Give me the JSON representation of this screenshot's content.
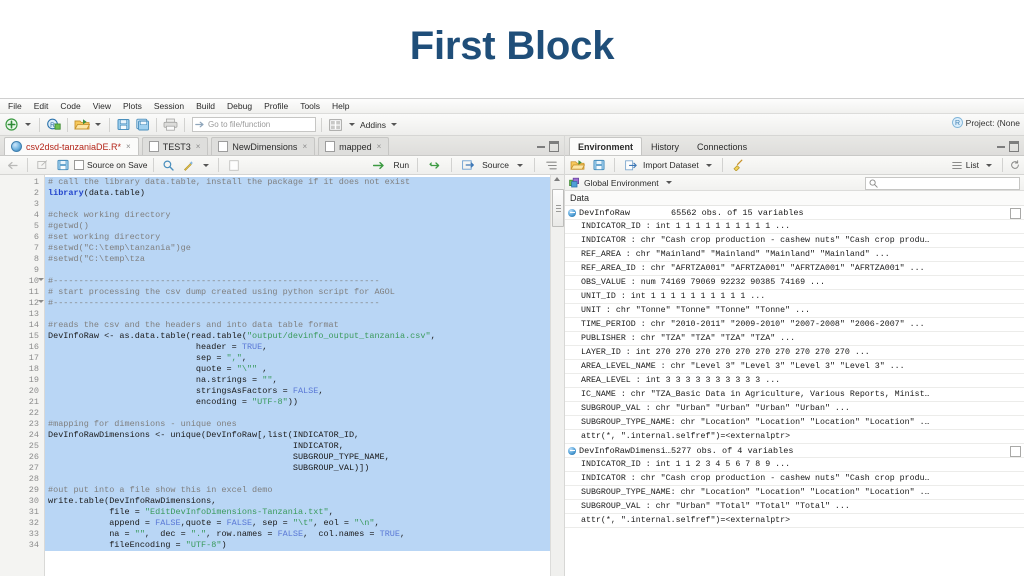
{
  "slide": {
    "title": "First Block"
  },
  "menubar": {
    "items": [
      "File",
      "Edit",
      "Code",
      "View",
      "Plots",
      "Session",
      "Build",
      "Debug",
      "Profile",
      "Tools",
      "Help"
    ]
  },
  "toolbar": {
    "goto_placeholder": "Go to file/function",
    "addins_label": "Addins",
    "project_label": "Project: (None"
  },
  "source_pane": {
    "tabs": [
      {
        "label": "csv2dsd-tanzaniaDE.R*",
        "icon": "r-script-icon",
        "active": true,
        "close": "×"
      },
      {
        "label": "TEST3",
        "icon": "file-icon",
        "active": false,
        "close": "×"
      },
      {
        "label": "NewDimensions",
        "icon": "file-icon",
        "active": false,
        "close": "×"
      },
      {
        "label": "mapped",
        "icon": "file-icon",
        "active": false,
        "close": "×"
      }
    ],
    "editor_toolbar": {
      "source_on_save": "Source on Save",
      "run_label": "Run",
      "source_label": "Source"
    },
    "gutter": [
      {
        "n": "1"
      },
      {
        "n": "2"
      },
      {
        "n": "3"
      },
      {
        "n": "4"
      },
      {
        "n": "5"
      },
      {
        "n": "6"
      },
      {
        "n": "7"
      },
      {
        "n": "8"
      },
      {
        "n": "9"
      },
      {
        "n": "10",
        "fold": true
      },
      {
        "n": "11"
      },
      {
        "n": "12",
        "fold": true
      },
      {
        "n": "13"
      },
      {
        "n": "14"
      },
      {
        "n": "15"
      },
      {
        "n": "16"
      },
      {
        "n": "17"
      },
      {
        "n": "18"
      },
      {
        "n": "19"
      },
      {
        "n": "20"
      },
      {
        "n": "21"
      },
      {
        "n": "22"
      },
      {
        "n": "23"
      },
      {
        "n": "24"
      },
      {
        "n": "25"
      },
      {
        "n": "26"
      },
      {
        "n": "27"
      },
      {
        "n": "28"
      },
      {
        "n": "29"
      },
      {
        "n": "30"
      },
      {
        "n": "31"
      },
      {
        "n": "32"
      },
      {
        "n": "33"
      },
      {
        "n": "34"
      }
    ],
    "code_lines": [
      [
        {
          "t": "# call the library data.table, install the package if it does not exist",
          "c": "cm"
        }
      ],
      [
        {
          "t": "library",
          "c": "kw"
        },
        {
          "t": "(data.table)",
          "c": "id"
        }
      ],
      [
        {
          "t": "",
          "c": "id"
        }
      ],
      [
        {
          "t": "#check working directory",
          "c": "cm"
        }
      ],
      [
        {
          "t": "#getwd()",
          "c": "cm"
        }
      ],
      [
        {
          "t": "#set working directory",
          "c": "cm"
        }
      ],
      [
        {
          "t": "#setwd(\"C:\\temp\\tanzania\")ge",
          "c": "cm"
        }
      ],
      [
        {
          "t": "#setwd(\"C:\\temp\\tza",
          "c": "cm"
        }
      ],
      [
        {
          "t": "",
          "c": "id"
        }
      ],
      [
        {
          "t": "#----------------------------------------------------------------",
          "c": "cm"
        }
      ],
      [
        {
          "t": "# start processing the csv dump created using python script for AGOL",
          "c": "cm"
        }
      ],
      [
        {
          "t": "#----------------------------------------------------------------",
          "c": "cm"
        }
      ],
      [
        {
          "t": "",
          "c": "id"
        }
      ],
      [
        {
          "t": "#reads the csv and the headers and into data table format",
          "c": "cm"
        }
      ],
      [
        {
          "t": "DevInfoRaw <- as.data.table(read.table(",
          "c": "id"
        },
        {
          "t": "\"output/devinfo_output_tanzania.csv\"",
          "c": "st"
        },
        {
          "t": ",",
          "c": "id"
        }
      ],
      [
        {
          "t": "                             header = ",
          "c": "id"
        },
        {
          "t": "TRUE",
          "c": "cn"
        },
        {
          "t": ",",
          "c": "id"
        }
      ],
      [
        {
          "t": "                             sep = ",
          "c": "id"
        },
        {
          "t": "\",\"",
          "c": "st"
        },
        {
          "t": ",",
          "c": "id"
        }
      ],
      [
        {
          "t": "                             quote = ",
          "c": "id"
        },
        {
          "t": "\"\\\"\"",
          "c": "st"
        },
        {
          "t": " ,",
          "c": "id"
        }
      ],
      [
        {
          "t": "                             na.strings = ",
          "c": "id"
        },
        {
          "t": "\"\"",
          "c": "st"
        },
        {
          "t": ",",
          "c": "id"
        }
      ],
      [
        {
          "t": "                             stringsAsFactors = ",
          "c": "id"
        },
        {
          "t": "FALSE",
          "c": "cn"
        },
        {
          "t": ",",
          "c": "id"
        }
      ],
      [
        {
          "t": "                             encoding = ",
          "c": "id"
        },
        {
          "t": "\"UTF-8\"",
          "c": "st"
        },
        {
          "t": "))",
          "c": "id"
        }
      ],
      [
        {
          "t": "",
          "c": "id"
        }
      ],
      [
        {
          "t": "#mapping for dimensions - unique ones",
          "c": "cm"
        }
      ],
      [
        {
          "t": "DevInfoRawDimensions <- unique(DevInfoRaw[,list(INDICATOR_ID,",
          "c": "id"
        }
      ],
      [
        {
          "t": "                                                INDICATOR,",
          "c": "id"
        }
      ],
      [
        {
          "t": "                                                SUBGROUP_TYPE_NAME,",
          "c": "id"
        }
      ],
      [
        {
          "t": "                                                SUBGROUP_VAL)])",
          "c": "id"
        }
      ],
      [
        {
          "t": "",
          "c": "id"
        }
      ],
      [
        {
          "t": "#out put into a file show this in excel demo",
          "c": "cm"
        }
      ],
      [
        {
          "t": "write.table(DevInfoRawDimensions,",
          "c": "id"
        }
      ],
      [
        {
          "t": "            file = ",
          "c": "id"
        },
        {
          "t": "\"EditDevInfoDimensions-Tanzania.txt\"",
          "c": "st"
        },
        {
          "t": ",",
          "c": "id"
        }
      ],
      [
        {
          "t": "            append = ",
          "c": "id"
        },
        {
          "t": "FALSE",
          "c": "cn"
        },
        {
          "t": ",quote = ",
          "c": "id"
        },
        {
          "t": "FALSE",
          "c": "cn"
        },
        {
          "t": ", sep = ",
          "c": "id"
        },
        {
          "t": "\"\\t\"",
          "c": "st"
        },
        {
          "t": ", eol = ",
          "c": "id"
        },
        {
          "t": "\"\\n\"",
          "c": "st"
        },
        {
          "t": ",",
          "c": "id"
        }
      ],
      [
        {
          "t": "            na = ",
          "c": "id"
        },
        {
          "t": "\"\"",
          "c": "st"
        },
        {
          "t": ",  dec = ",
          "c": "id"
        },
        {
          "t": "\".\"",
          "c": "st"
        },
        {
          "t": ", row.names = ",
          "c": "id"
        },
        {
          "t": "FALSE",
          "c": "cn"
        },
        {
          "t": ",  col.names = ",
          "c": "id"
        },
        {
          "t": "TRUE",
          "c": "cn"
        },
        {
          "t": ",",
          "c": "id"
        }
      ],
      [
        {
          "t": "            fileEncoding = ",
          "c": "id"
        },
        {
          "t": "\"UTF-8\"",
          "c": "st"
        },
        {
          "t": ")",
          "c": "id"
        }
      ]
    ]
  },
  "env_pane": {
    "tabs": [
      {
        "label": "Environment",
        "active": true
      },
      {
        "label": "History",
        "active": false
      },
      {
        "label": "Connections",
        "active": false
      }
    ],
    "toolbar": {
      "import_dataset": "Import Dataset",
      "list_label": "List"
    },
    "global_environment": "Global Environment",
    "section_label": "Data",
    "objects": [
      {
        "name": "DevInfoRaw",
        "desc": "65562 obs. of 15 variables",
        "vars": [
          "INDICATOR_ID : int 1 1 1 1 1 1 1 1 1 1 ...",
          "INDICATOR : chr  \"Cash crop production - cashew nuts\" \"Cash crop produ…",
          "REF_AREA : chr  \"Mainland\" \"Mainland\" \"Mainland\" \"Mainland\" ...",
          "REF_AREA_ID : chr  \"AFRTZA001\" \"AFRTZA001\" \"AFRTZA001\" \"AFRTZA001\" ...",
          "OBS_VALUE : num  74169 79069 92232 90385 74169 ...",
          "UNIT_ID : int  1 1 1 1 1 1 1 1 1 1 ...",
          "UNIT : chr  \"Tonne\" \"Tonne\" \"Tonne\" \"Tonne\" ...",
          "TIME_PERIOD : chr  \"2010-2011\" \"2009-2010\" \"2007-2008\" \"2006-2007\" ...",
          "PUBLISHER : chr  \"TZA\" \"TZA\" \"TZA\" \"TZA\" ...",
          "LAYER_ID : int  270 270 270 270 270 270 270 270 270 270 ...",
          "AREA_LEVEL_NAME : chr  \"Level 3\" \"Level 3\" \"Level 3\" \"Level 3\" ...",
          "AREA_LEVEL : int  3 3 3 3 3 3 3 3 3 3 ...",
          "IC_NAME : chr  \"TZA_Basic Data in Agriculture, Various Reports, Minist…",
          "SUBGROUP_VAL : chr  \"Urban\" \"Urban\" \"Urban\" \"Urban\" ...",
          "SUBGROUP_TYPE_NAME: chr  \"Location\" \"Location\" \"Location\" \"Location\" .…"
        ],
        "attr": "attr(*, \".internal.selfref\")=<externalptr>"
      },
      {
        "name": "DevInfoRawDimensi…",
        "desc": "5277 obs. of 4 variables",
        "vars": [
          "INDICATOR_ID : int  1 1 2 3 4 5 6 7 8 9 ...",
          "INDICATOR : chr  \"Cash crop production - cashew nuts\" \"Cash crop produ…",
          "SUBGROUP_TYPE_NAME: chr  \"Location\" \"Location\" \"Location\" \"Location\" .…",
          "SUBGROUP_VAL : chr  \"Urban\" \"Total\" \"Total\" \"Total\" ..."
        ],
        "attr": "attr(*, \".internal.selfref\")=<externalptr>"
      }
    ]
  },
  "colors": {
    "title": "#1F4E79",
    "selection": "#b9d6f5",
    "comment": "#7f7f7f",
    "string": "#3a9a5c",
    "keyword": "#2244cc",
    "constant": "#5b79d6",
    "active_tab_text": "#b4261a"
  }
}
